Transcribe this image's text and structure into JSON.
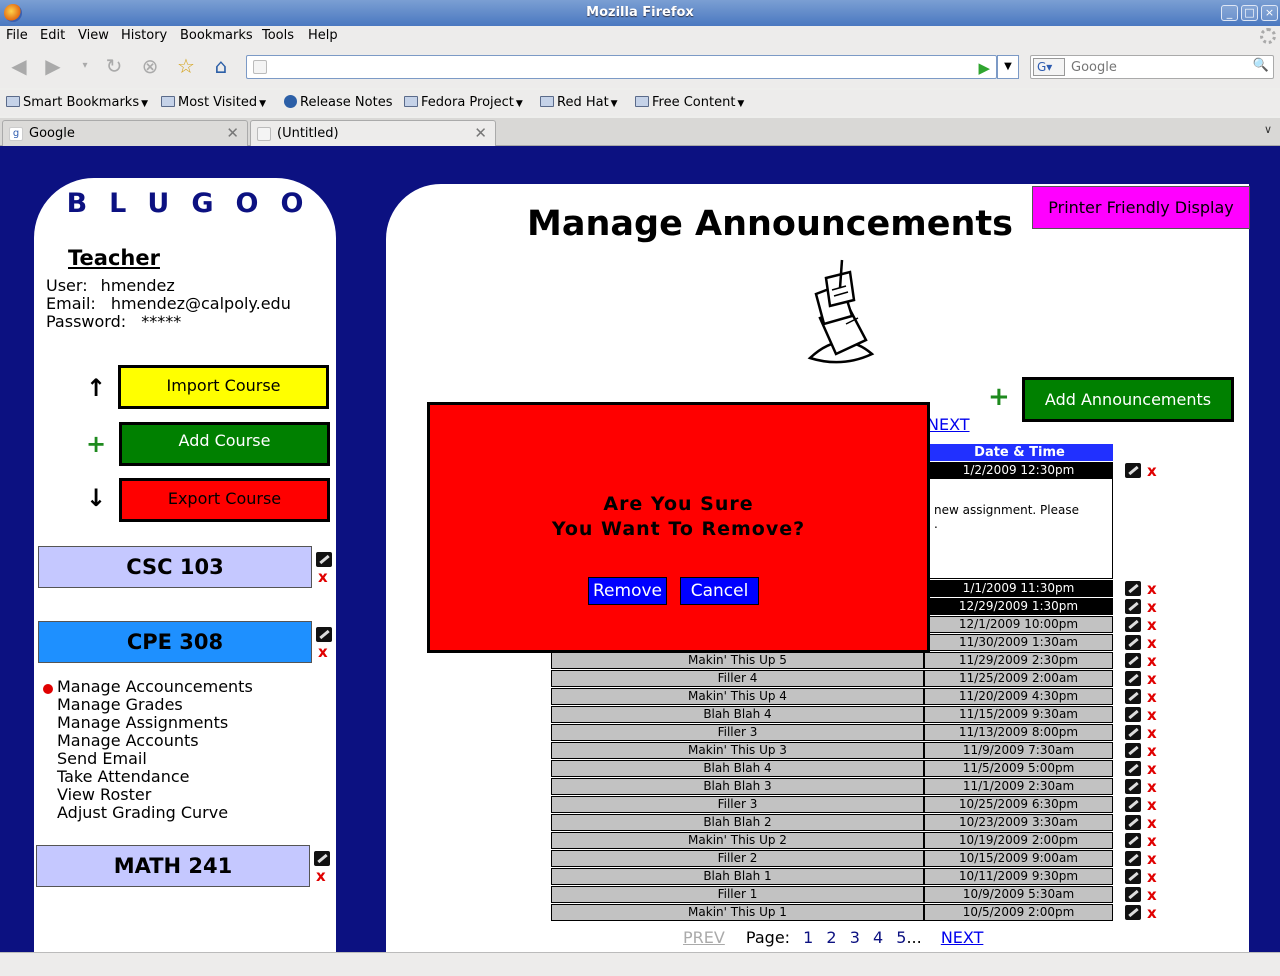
{
  "window": {
    "title": "Mozilla Firefox"
  },
  "menubar": [
    "File",
    "Edit",
    "View",
    "History",
    "Bookmarks",
    "Tools",
    "Help"
  ],
  "navbar": {
    "url_value": "",
    "search_placeholder": "Google"
  },
  "bookmarks": [
    "Smart Bookmarks",
    "Most Visited",
    "Release Notes",
    "Fedora Project",
    "Red Hat",
    "Free Content"
  ],
  "tabs": [
    {
      "label": "Google"
    },
    {
      "label": "(Untitled)"
    }
  ],
  "sidebar": {
    "logo": "BLUGOO",
    "role_heading": "Teacher",
    "user_label": "User:",
    "user_value": "hmendez",
    "email_label": "Email:",
    "email_value": "hmendez@calpoly.edu",
    "password_label": "Password:",
    "password_value": "*****",
    "import_course": "Import Course",
    "add_course": "Add Course",
    "export_course": "Export Course",
    "courses": [
      "CSC 103",
      "CPE 308",
      "MATH 241"
    ],
    "menu": [
      "Manage Accouncements",
      "Manage Grades",
      "Manage Assignments",
      "Manage Accounts",
      "Send Email",
      "Take Attendance",
      "View Roster",
      "Adjust Grading Curve"
    ],
    "colors": {
      "import": "#ffff00",
      "add": "#008000",
      "export": "#ff0000",
      "course_light": "#c5c8ff",
      "course_active": "#1e90ff"
    }
  },
  "main": {
    "title": "Manage Announcements",
    "printer_friendly": "Printer Friendly Display",
    "add_announcements": "Add Announcements",
    "next_top": "NEXT",
    "date_header": "Date & Time",
    "expanded_text": "new assignment. Please",
    "expanded_text2": ".",
    "rows_dark": [
      {
        "date": "1/2/2009   12:30pm"
      },
      {
        "date": "1/1/2009   11:30pm"
      },
      {
        "date": "12/29/2009   1:30pm"
      }
    ],
    "rows": [
      {
        "title": "",
        "date": "12/1/2009   10:00pm"
      },
      {
        "title": "",
        "date": "11/30/2009   1:30am"
      },
      {
        "title": "Makin' This Up 5",
        "date": "11/29/2009   2:30pm"
      },
      {
        "title": "Filler 4",
        "date": "11/25/2009   2:00am"
      },
      {
        "title": "Makin' This Up 4",
        "date": "11/20/2009   4:30pm"
      },
      {
        "title": "Blah Blah 4",
        "date": "11/15/2009   9:30am"
      },
      {
        "title": "Filler 3",
        "date": "11/13/2009   8:00pm"
      },
      {
        "title": "Makin' This Up 3",
        "date": "11/9/2009   7:30am"
      },
      {
        "title": "Blah Blah 4",
        "date": "11/5/2009   5:00pm"
      },
      {
        "title": "Blah Blah 3",
        "date": "11/1/2009   2:30am"
      },
      {
        "title": "Filler 3",
        "date": "10/25/2009   6:30pm"
      },
      {
        "title": "Blah Blah 2",
        "date": "10/23/2009   3:30am"
      },
      {
        "title": "Makin' This Up 2",
        "date": "10/19/2009   2:00pm"
      },
      {
        "title": "Filler 2",
        "date": "10/15/2009   9:00am"
      },
      {
        "title": "Blah Blah 1",
        "date": "10/11/2009   9:30pm"
      },
      {
        "title": "Filler 1",
        "date": "10/9/2009   5:30am"
      },
      {
        "title": "Makin' This Up 1",
        "date": "10/5/2009   2:00pm"
      }
    ],
    "pager": {
      "prev": "PREV",
      "label": "Page:",
      "pages": [
        "1",
        "2",
        "3",
        "4",
        "5"
      ],
      "ellipsis": "...",
      "next": "NEXT"
    }
  },
  "modal": {
    "line1": "Are You Sure",
    "line2": "You Want To Remove?",
    "remove": "Remove",
    "cancel": "Cancel"
  },
  "icons": [
    "firefox-icon",
    "back-icon",
    "forward-icon",
    "reload-icon",
    "stop-icon",
    "bookmark-star-icon",
    "home-icon",
    "go-icon",
    "search-icon",
    "edit-icon",
    "delete-icon",
    "announcement-icon"
  ]
}
